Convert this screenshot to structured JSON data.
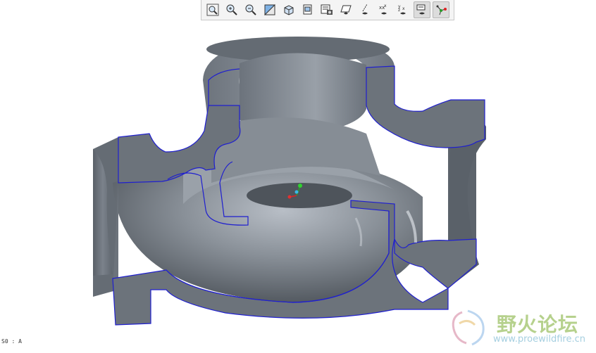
{
  "toolbar": {
    "buttons": [
      {
        "name": "refit-button",
        "icon": "zoom-fit-icon",
        "active": false
      },
      {
        "name": "zoom-in-button",
        "icon": "zoom-in-icon",
        "active": false
      },
      {
        "name": "zoom-out-button",
        "icon": "zoom-out-icon",
        "active": false
      },
      {
        "name": "repaint-button",
        "icon": "repaint-icon",
        "active": false
      },
      {
        "name": "display-style-button",
        "icon": "cube-icon",
        "active": false
      },
      {
        "name": "saved-orientations-button",
        "icon": "saved-views-icon",
        "active": false
      },
      {
        "name": "view-manager-button",
        "icon": "view-manager-icon",
        "active": false
      },
      {
        "name": "plane-display-button",
        "icon": "plane-display-icon",
        "active": false
      },
      {
        "name": "axis-display-button",
        "icon": "axis-display-icon",
        "active": false
      },
      {
        "name": "point-display-button",
        "icon": "point-display-icon",
        "active": false
      },
      {
        "name": "csys-display-button",
        "icon": "csys-display-icon",
        "active": false
      },
      {
        "name": "annotation-display-button",
        "icon": "annotation-display-icon",
        "active": true
      },
      {
        "name": "spin-center-button",
        "icon": "spin-center-icon",
        "active": true
      }
    ]
  },
  "viewport": {
    "csys_label": "S0 : A",
    "model": "valve-body-cross-section",
    "colors": {
      "body": "#6f767f",
      "edge": "#1f1fcf",
      "background": "#ffffff"
    }
  },
  "watermark": {
    "text": "野火论坛",
    "url": "www.proewildfire.cn"
  }
}
